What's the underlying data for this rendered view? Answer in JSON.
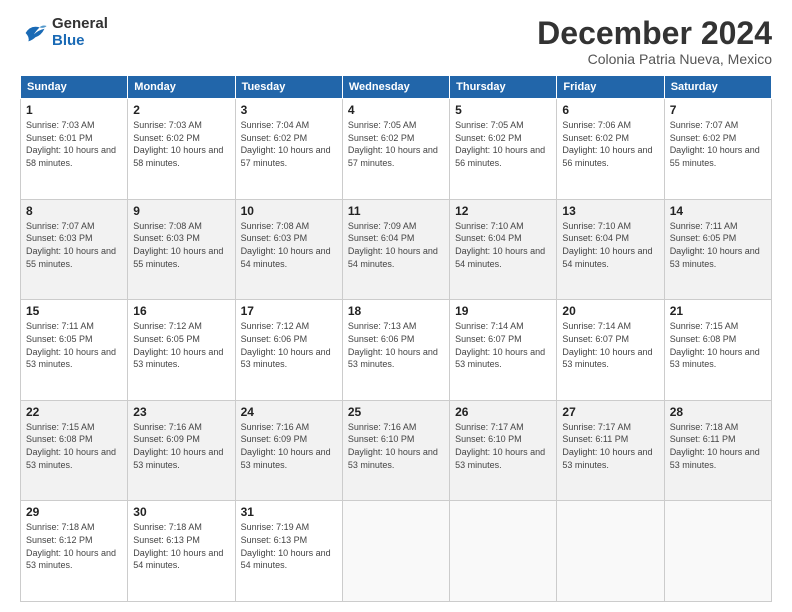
{
  "logo": {
    "general": "General",
    "blue": "Blue"
  },
  "header": {
    "month": "December 2024",
    "location": "Colonia Patria Nueva, Mexico"
  },
  "weekdays": [
    "Sunday",
    "Monday",
    "Tuesday",
    "Wednesday",
    "Thursday",
    "Friday",
    "Saturday"
  ],
  "weeks": [
    [
      {
        "day": "1",
        "sunrise": "7:03 AM",
        "sunset": "6:01 PM",
        "daylight": "10 hours and 58 minutes."
      },
      {
        "day": "2",
        "sunrise": "7:03 AM",
        "sunset": "6:02 PM",
        "daylight": "10 hours and 58 minutes."
      },
      {
        "day": "3",
        "sunrise": "7:04 AM",
        "sunset": "6:02 PM",
        "daylight": "10 hours and 57 minutes."
      },
      {
        "day": "4",
        "sunrise": "7:05 AM",
        "sunset": "6:02 PM",
        "daylight": "10 hours and 57 minutes."
      },
      {
        "day": "5",
        "sunrise": "7:05 AM",
        "sunset": "6:02 PM",
        "daylight": "10 hours and 56 minutes."
      },
      {
        "day": "6",
        "sunrise": "7:06 AM",
        "sunset": "6:02 PM",
        "daylight": "10 hours and 56 minutes."
      },
      {
        "day": "7",
        "sunrise": "7:07 AM",
        "sunset": "6:02 PM",
        "daylight": "10 hours and 55 minutes."
      }
    ],
    [
      {
        "day": "8",
        "sunrise": "7:07 AM",
        "sunset": "6:03 PM",
        "daylight": "10 hours and 55 minutes."
      },
      {
        "day": "9",
        "sunrise": "7:08 AM",
        "sunset": "6:03 PM",
        "daylight": "10 hours and 55 minutes."
      },
      {
        "day": "10",
        "sunrise": "7:08 AM",
        "sunset": "6:03 PM",
        "daylight": "10 hours and 54 minutes."
      },
      {
        "day": "11",
        "sunrise": "7:09 AM",
        "sunset": "6:04 PM",
        "daylight": "10 hours and 54 minutes."
      },
      {
        "day": "12",
        "sunrise": "7:10 AM",
        "sunset": "6:04 PM",
        "daylight": "10 hours and 54 minutes."
      },
      {
        "day": "13",
        "sunrise": "7:10 AM",
        "sunset": "6:04 PM",
        "daylight": "10 hours and 54 minutes."
      },
      {
        "day": "14",
        "sunrise": "7:11 AM",
        "sunset": "6:05 PM",
        "daylight": "10 hours and 53 minutes."
      }
    ],
    [
      {
        "day": "15",
        "sunrise": "7:11 AM",
        "sunset": "6:05 PM",
        "daylight": "10 hours and 53 minutes."
      },
      {
        "day": "16",
        "sunrise": "7:12 AM",
        "sunset": "6:05 PM",
        "daylight": "10 hours and 53 minutes."
      },
      {
        "day": "17",
        "sunrise": "7:12 AM",
        "sunset": "6:06 PM",
        "daylight": "10 hours and 53 minutes."
      },
      {
        "day": "18",
        "sunrise": "7:13 AM",
        "sunset": "6:06 PM",
        "daylight": "10 hours and 53 minutes."
      },
      {
        "day": "19",
        "sunrise": "7:14 AM",
        "sunset": "6:07 PM",
        "daylight": "10 hours and 53 minutes."
      },
      {
        "day": "20",
        "sunrise": "7:14 AM",
        "sunset": "6:07 PM",
        "daylight": "10 hours and 53 minutes."
      },
      {
        "day": "21",
        "sunrise": "7:15 AM",
        "sunset": "6:08 PM",
        "daylight": "10 hours and 53 minutes."
      }
    ],
    [
      {
        "day": "22",
        "sunrise": "7:15 AM",
        "sunset": "6:08 PM",
        "daylight": "10 hours and 53 minutes."
      },
      {
        "day": "23",
        "sunrise": "7:16 AM",
        "sunset": "6:09 PM",
        "daylight": "10 hours and 53 minutes."
      },
      {
        "day": "24",
        "sunrise": "7:16 AM",
        "sunset": "6:09 PM",
        "daylight": "10 hours and 53 minutes."
      },
      {
        "day": "25",
        "sunrise": "7:16 AM",
        "sunset": "6:10 PM",
        "daylight": "10 hours and 53 minutes."
      },
      {
        "day": "26",
        "sunrise": "7:17 AM",
        "sunset": "6:10 PM",
        "daylight": "10 hours and 53 minutes."
      },
      {
        "day": "27",
        "sunrise": "7:17 AM",
        "sunset": "6:11 PM",
        "daylight": "10 hours and 53 minutes."
      },
      {
        "day": "28",
        "sunrise": "7:18 AM",
        "sunset": "6:11 PM",
        "daylight": "10 hours and 53 minutes."
      }
    ],
    [
      {
        "day": "29",
        "sunrise": "7:18 AM",
        "sunset": "6:12 PM",
        "daylight": "10 hours and 53 minutes."
      },
      {
        "day": "30",
        "sunrise": "7:18 AM",
        "sunset": "6:13 PM",
        "daylight": "10 hours and 54 minutes."
      },
      {
        "day": "31",
        "sunrise": "7:19 AM",
        "sunset": "6:13 PM",
        "daylight": "10 hours and 54 minutes."
      },
      null,
      null,
      null,
      null
    ]
  ]
}
